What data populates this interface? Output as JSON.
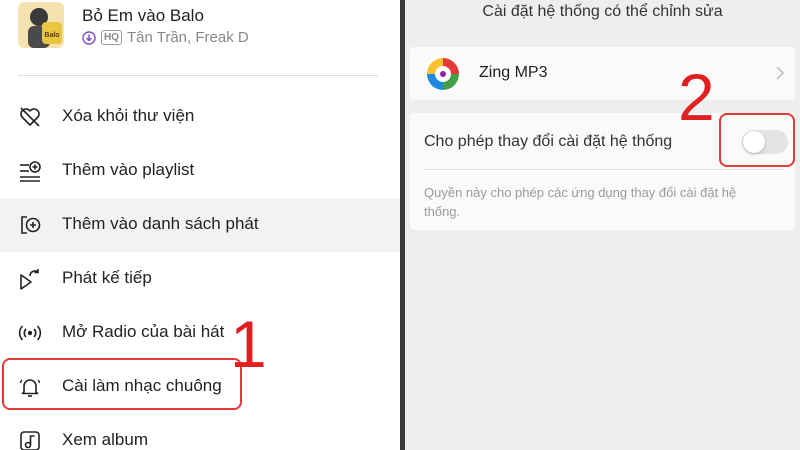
{
  "song": {
    "title": "Bỏ Em vào Balo",
    "quality_badge": "HQ",
    "artists": "Tân Trần, Freak D",
    "cover_text": "Balo"
  },
  "menu": {
    "items": [
      {
        "label": "Xóa khỏi thư viện",
        "icon": "heart-broken-icon"
      },
      {
        "label": "Thêm vào playlist",
        "icon": "playlist-add-icon"
      },
      {
        "label": "Thêm vào danh sách phát",
        "icon": "queue-add-icon"
      },
      {
        "label": "Phát kế tiếp",
        "icon": "play-next-icon"
      },
      {
        "label": "Mở Radio của bài hát",
        "icon": "radio-icon"
      },
      {
        "label": "Cài làm nhạc chuông",
        "icon": "bell-ringing-icon"
      },
      {
        "label": "Xem album",
        "icon": "music-note-icon"
      }
    ]
  },
  "annotations": {
    "step1": "1",
    "step2": "2",
    "highlight_color": "#e63939"
  },
  "settings": {
    "title": "Cài đặt hệ thống có thể chỉnh sửa",
    "app_name": "Zing MP3",
    "permission_label": "Cho phép thay đổi cài đặt hệ thống",
    "permission_desc": "Quyền này cho phép các ứng dụng thay đổi cài đặt hệ thống.",
    "toggle_on": false
  }
}
